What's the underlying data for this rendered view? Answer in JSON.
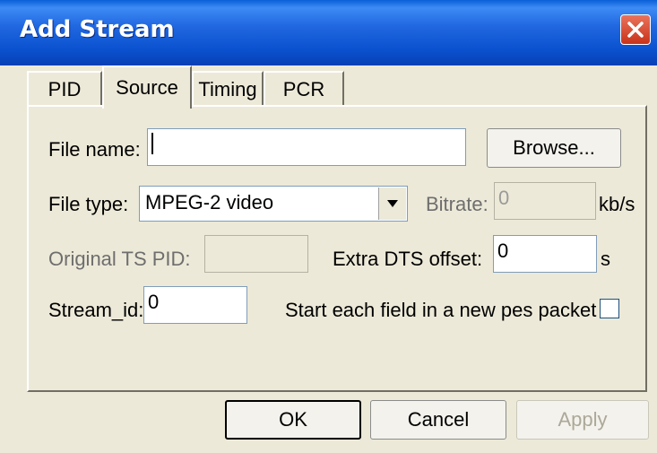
{
  "window": {
    "title": "Add Stream"
  },
  "tabs": [
    {
      "label": "PID"
    },
    {
      "label": "Source"
    },
    {
      "label": "Timing"
    },
    {
      "label": "PCR"
    }
  ],
  "form": {
    "file_name_label": "File name:",
    "file_name_value": "",
    "browse_label": "Browse...",
    "file_type_label": "File type:",
    "file_type_value": "MPEG-2 video",
    "bitrate_label": "Bitrate:",
    "bitrate_value": "0",
    "bitrate_unit": "kb/s",
    "original_ts_pid_label": "Original TS PID:",
    "original_ts_pid_value": "",
    "extra_dts_label": "Extra DTS offset:",
    "extra_dts_value": "0",
    "extra_dts_unit": "s",
    "stream_id_label": "Stream_id:",
    "stream_id_value": "0",
    "start_field_label": "Start each field in a new pes packet",
    "start_field_checked": false
  },
  "buttons": {
    "ok": "OK",
    "cancel": "Cancel",
    "apply": "Apply"
  }
}
